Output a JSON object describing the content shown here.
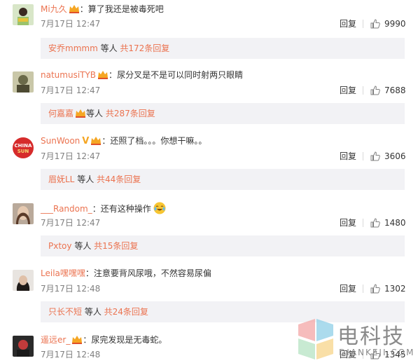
{
  "comments": [
    {
      "username": "Mi九久",
      "verified": false,
      "text": "算了我还是被毒死吧",
      "time": "7月17日 12:47",
      "reply_label": "回复",
      "likes": "9990",
      "reply_summary": {
        "name": "安乔mmmm",
        "mid": " 等人 ",
        "count": "共172条回复"
      }
    },
    {
      "username": "natumusiTYB",
      "verified": false,
      "text": "尿分叉是不是可以同时射两只眼睛",
      "time": "7月17日 12:47",
      "reply_label": "回复",
      "likes": "7688",
      "reply_summary": {
        "name": "何嘉嘉",
        "mid": "等人 ",
        "count": "共287条回复"
      }
    },
    {
      "username": "SunWoon",
      "verified": true,
      "verified_mark": "V",
      "text": "还照了档。。。你想干嘛。。",
      "time": "7月17日 12:47",
      "reply_label": "回复",
      "likes": "3606",
      "reply_summary": {
        "name": "眉妩LL",
        "mid": " 等人 ",
        "count": "共44条回复"
      }
    },
    {
      "username": "___Random_",
      "verified": false,
      "text": "还有这种操作",
      "time": "7月17日 12:47",
      "reply_label": "回复",
      "likes": "1480",
      "reply_summary": {
        "name": "Pxtoy",
        "mid": " 等人 ",
        "count": "共15条回复"
      }
    },
    {
      "username": "Leila嘿嘿嘿",
      "verified": false,
      "text": "注意要背风尿哦，不然容易尿偏",
      "time": "7月17日 12:48",
      "reply_label": "回复",
      "likes": "1302",
      "reply_summary": {
        "name": "只长不短",
        "mid": " 等人 ",
        "count": "共24条回复"
      }
    },
    {
      "username": "遥远er_",
      "verified": false,
      "text": "尿完发现是无毒蛇。",
      "time": "7月17日 12:48",
      "reply_label": "回复",
      "likes": "1345"
    }
  ],
  "separator": "：",
  "watermark": {
    "brand": "电科技",
    "domain": "DIANKEJI.COM"
  },
  "icons": {
    "like": "thumbs-up-icon",
    "crown": "crown-badge-icon",
    "laugh": "laugh-cry-emoji-icon"
  },
  "colors": {
    "username": "#eb7350",
    "reply_bg": "#f2f2f5",
    "meta": "#808080",
    "verified": "#f5a623"
  }
}
